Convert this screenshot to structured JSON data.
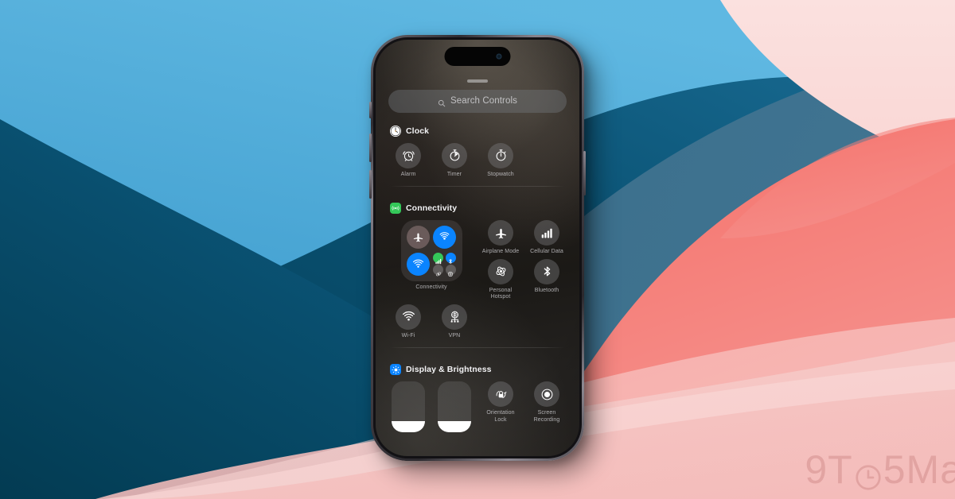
{
  "background": {
    "colors": {
      "deep_blue": "#064a64",
      "sky_blue": "#4daad8",
      "steel_blue": "#3e6f89",
      "coral": "#f4736c",
      "salmon": "#f2908c",
      "pink": "#f6c4c3",
      "light_pink": "#fbdedd",
      "pale_pink": "#fae3e1"
    }
  },
  "watermark": {
    "text_left": "9T",
    "text_right": "5Ma",
    "icon": "clock-icon"
  },
  "device": {
    "name": "iPhone",
    "buttons": [
      "action-button",
      "volume-up-button",
      "volume-down-button",
      "power-button"
    ],
    "dynamic_island": "dynamic-island"
  },
  "control_center": {
    "grabber": "drag-handle",
    "search": {
      "placeholder": "Search Controls",
      "icon": "search-icon"
    },
    "sections": [
      {
        "id": "clock",
        "title": "Clock",
        "badge_icon": "clock-app-icon",
        "badge_color": "#ffffff",
        "controls": [
          {
            "label": "Alarm",
            "icon": "alarm-clock-icon",
            "state": "off"
          },
          {
            "label": "Timer",
            "icon": "timer-icon",
            "state": "off"
          },
          {
            "label": "Stopwatch",
            "icon": "stopwatch-icon",
            "state": "off"
          }
        ]
      },
      {
        "id": "connectivity",
        "title": "Connectivity",
        "badge_icon": "connectivity-icon",
        "badge_color": "#34c759",
        "module": {
          "label": "Connectivity",
          "buttons": [
            {
              "name": "airplane-mode",
              "icon": "airplane-icon",
              "state": "off"
            },
            {
              "name": "airdrop",
              "icon": "airdrop-icon",
              "state": "on"
            },
            {
              "name": "wifi",
              "icon": "wifi-icon",
              "state": "on"
            }
          ],
          "mini_buttons": [
            {
              "name": "cellular-data",
              "icon": "signal-bars-icon",
              "state": "on",
              "color": "#34c759"
            },
            {
              "name": "bluetooth",
              "icon": "bluetooth-icon",
              "state": "on",
              "color": "#0a84ff"
            },
            {
              "name": "satellite",
              "icon": "satellite-icon",
              "state": "off",
              "color": "#969494"
            },
            {
              "name": "vpn",
              "icon": "vpn-icon",
              "state": "off",
              "color": "#969494"
            }
          ]
        },
        "controls": [
          {
            "label": "Airplane Mode",
            "icon": "airplane-icon",
            "state": "off"
          },
          {
            "label": "Cellular Data",
            "icon": "cellular-icon",
            "state": "off"
          },
          {
            "label": "Personal Hotspot",
            "icon": "hotspot-icon",
            "state": "off"
          },
          {
            "label": "Bluetooth",
            "icon": "bluetooth-icon",
            "state": "off"
          },
          {
            "label": "Wi-Fi",
            "icon": "wifi-icon",
            "state": "off"
          },
          {
            "label": "VPN",
            "icon": "vpn-globe-icon",
            "state": "off"
          }
        ]
      },
      {
        "id": "display-brightness",
        "title": "Display & Brightness",
        "badge_icon": "brightness-icon",
        "badge_color": "#0a84ff",
        "sliders": [
          {
            "name": "brightness-slider",
            "value_percent": 22
          },
          {
            "name": "volume-slider",
            "value_percent": 22
          }
        ],
        "controls": [
          {
            "label": "Orientation Lock",
            "icon": "rotation-lock-icon",
            "state": "off"
          },
          {
            "label": "Screen Recording",
            "icon": "screen-record-icon",
            "state": "off"
          }
        ]
      }
    ]
  }
}
